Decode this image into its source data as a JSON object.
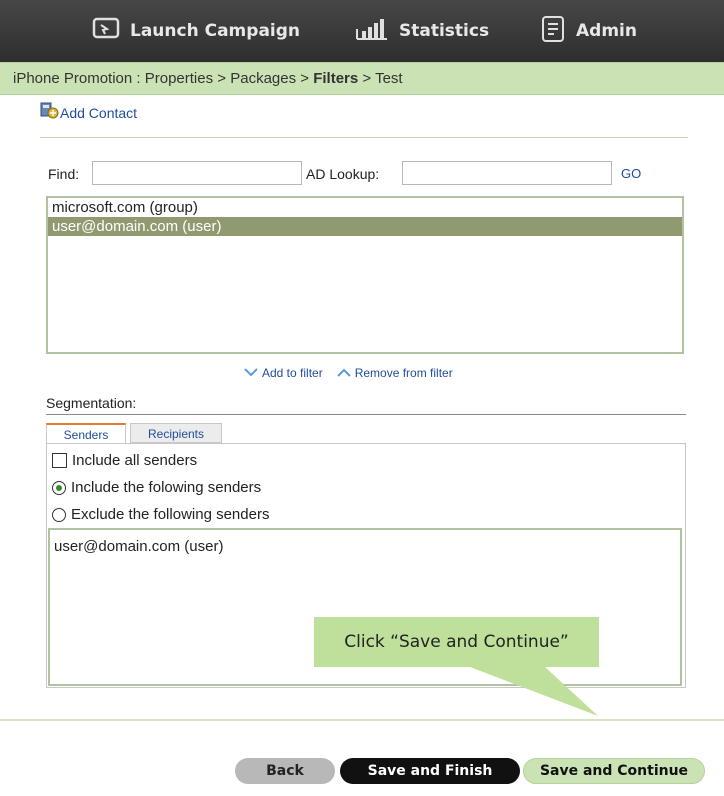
{
  "nav": {
    "launch_label": "Launch Campaign",
    "statistics_label": "Statistics",
    "admin_label": "Admin",
    "icons": [
      "monitor-icon",
      "bar-chart-icon",
      "document-icon"
    ]
  },
  "breadcrumb": {
    "part1": "iPhone Promotion : Properties",
    "part2": "Packages",
    "current": "Filters",
    "part4": "Test",
    "separator": ">"
  },
  "add_contact": {
    "label": "Add Contact",
    "icon": "contacts-icon"
  },
  "search": {
    "find_label": "Find:",
    "find_value": "",
    "ad_lookup_label": "AD Lookup:",
    "ad_lookup_value": "",
    "go_label": "GO"
  },
  "results": {
    "items": [
      "microsoft.com (group)",
      "user@domain.com (user)"
    ],
    "selected_index": 1
  },
  "filter_actions": {
    "add_label": "Add to filter",
    "remove_label": "Remove from filter"
  },
  "segmentation": {
    "label": "Segmentation:",
    "tabs": [
      "Senders",
      "Recipients"
    ],
    "active_tab": "Senders",
    "option_include_all": "Include all senders",
    "option_include_following": "Include the folowing senders",
    "option_exclude_following": "Exclude the following senders",
    "selected_option": "Include the folowing senders",
    "senders": [
      "user@domain.com (user)"
    ]
  },
  "callout": {
    "text": "Click “Save and Continue”"
  },
  "buttons": {
    "back": "Back",
    "save_finish": "Save and Finish",
    "save_continue": "Save and Continue"
  },
  "colors": {
    "nav_bg": "#3a3a3a",
    "accent_green": "#cbe3b4",
    "selected_row": "#8f9a70",
    "link_blue": "#1f4d9a"
  }
}
